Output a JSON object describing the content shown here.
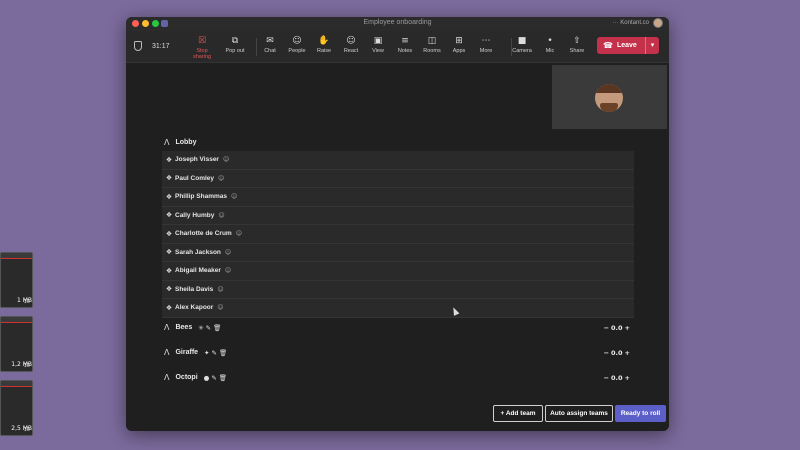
{
  "desktop": {
    "thumbnails": [
      {
        "label": "1 MB",
        "inner": "10"
      },
      {
        "label": "1,2 MB",
        "inner": "10"
      },
      {
        "label": "2,5 MB",
        "inner": "10"
      }
    ]
  },
  "window": {
    "title": "Employee onboarding",
    "account_label": "···  Kontant.co"
  },
  "toolbar": {
    "call_time": "31:17",
    "items": [
      {
        "label": "Stop sharing",
        "icon": "stop-share-icon",
        "glyph": "☒",
        "active": true
      },
      {
        "label": "Pop out",
        "icon": "pop-out-icon",
        "glyph": "⧉"
      },
      {
        "label": "Chat",
        "icon": "chat-icon",
        "glyph": "✉"
      },
      {
        "label": "People",
        "icon": "people-icon",
        "glyph": "☺"
      },
      {
        "label": "Raise",
        "icon": "raise-hand-icon",
        "glyph": "✋"
      },
      {
        "label": "React",
        "icon": "react-icon",
        "glyph": "☺"
      },
      {
        "label": "View",
        "icon": "view-icon",
        "glyph": "▣"
      },
      {
        "label": "Notes",
        "icon": "notes-icon",
        "glyph": "≡"
      },
      {
        "label": "Rooms",
        "icon": "rooms-icon",
        "glyph": "◫"
      },
      {
        "label": "Apps",
        "icon": "apps-icon",
        "glyph": "⊞"
      },
      {
        "label": "More",
        "icon": "more-icon",
        "glyph": "⋯"
      },
      {
        "label": "Camera",
        "icon": "camera-icon",
        "glyph": "■"
      },
      {
        "label": "Mic",
        "icon": "mic-icon",
        "glyph": "•"
      },
      {
        "label": "Share",
        "icon": "share-icon",
        "glyph": "⇧"
      }
    ],
    "leave_label": "Leave"
  },
  "lobby": {
    "title": "Lobby",
    "people": [
      "Joseph Visser",
      "Paul Comley",
      "Phillip Shammas",
      "Cally Humby",
      "Charlotte de Crum",
      "Sarah Jackson",
      "Abigail Meaker",
      "Sheila Davis",
      "Alex Kapoor"
    ]
  },
  "teams": [
    {
      "name": "Bees",
      "emoji": "✳",
      "score": "0.0"
    },
    {
      "name": "Giraffe",
      "emoji": "✦",
      "score": "0.0"
    },
    {
      "name": "Octopi",
      "emoji": "●",
      "score": "0.0"
    }
  ],
  "actions": {
    "add_team": "+ Add team",
    "auto_assign": "Auto assign teams",
    "ready": "Ready to roll"
  },
  "colors": {
    "accent": "#5b5fc7",
    "leave": "#c4314b",
    "desktop": "#7b6a9c"
  }
}
